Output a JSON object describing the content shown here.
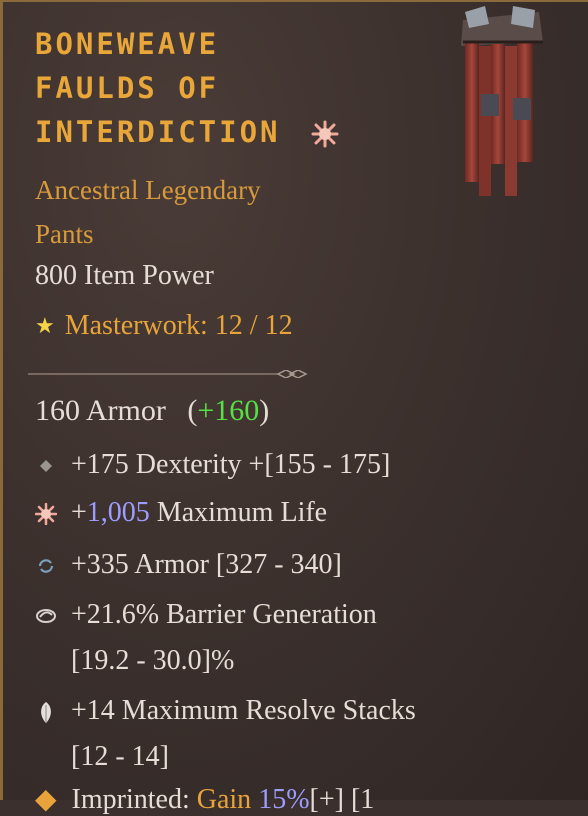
{
  "item": {
    "name_lines": [
      "BONEWEAVE",
      "FAULDS OF",
      "INTERDICTION"
    ],
    "type_line1": "Ancestral Legendary",
    "type_line2": "Pants",
    "item_power": "800 Item Power",
    "masterwork": "Masterwork: 12 / 12"
  },
  "armor": {
    "base": "160 Armor",
    "open_paren": "(",
    "delta": "+160",
    "close_paren": ")"
  },
  "affixes": [
    {
      "icon": "diamond-icon",
      "text": "+175 Dexterity +[155 - 175]"
    },
    {
      "icon": "starburst-icon",
      "prefix": "+",
      "value": "1,005",
      "suffix": " Maximum Life"
    },
    {
      "icon": "rotate-icon",
      "text": "+335 Armor [327 - 340]"
    },
    {
      "icon": "swirl-icon",
      "line1": "+21.6% Barrier Generation",
      "line2": "[19.2 - 30.0]%"
    },
    {
      "icon": "feather-icon",
      "line1": "+14 Maximum Resolve Stacks",
      "line2": "[12 - 14]"
    }
  ],
  "imprint": {
    "label": "Imprinted:",
    "keyword": "Gain",
    "value": "15%",
    "rest": "[+] [1"
  },
  "colors": {
    "title": "#e9a73a",
    "legendary": "#d99a3c",
    "positive": "#56e046",
    "numeric_highlight": "#9d9cff",
    "text": "#e6ded6"
  }
}
